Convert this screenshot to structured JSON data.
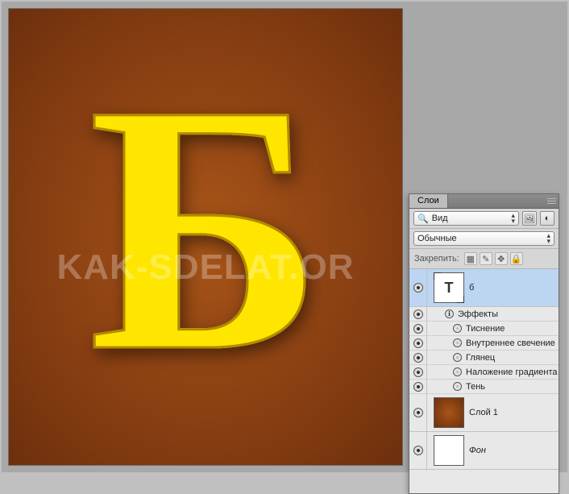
{
  "canvas": {
    "letter": "Б",
    "watermark": "KAK-SDELAT.OR"
  },
  "panel": {
    "tab_title": "Слои",
    "search_label": "Вид",
    "blend_mode": "Обычные",
    "lock_label": "Закрепить:"
  },
  "layers": {
    "text_layer": {
      "thumb_glyph": "T",
      "name": "б"
    },
    "effects_label": "Эффекты",
    "fx": [
      "Тиснение",
      "Внутреннее свечение",
      "Глянец",
      "Наложение градиента",
      "Тень"
    ],
    "layer1": {
      "name": "Слой 1"
    },
    "background": {
      "name": "Фон"
    }
  }
}
